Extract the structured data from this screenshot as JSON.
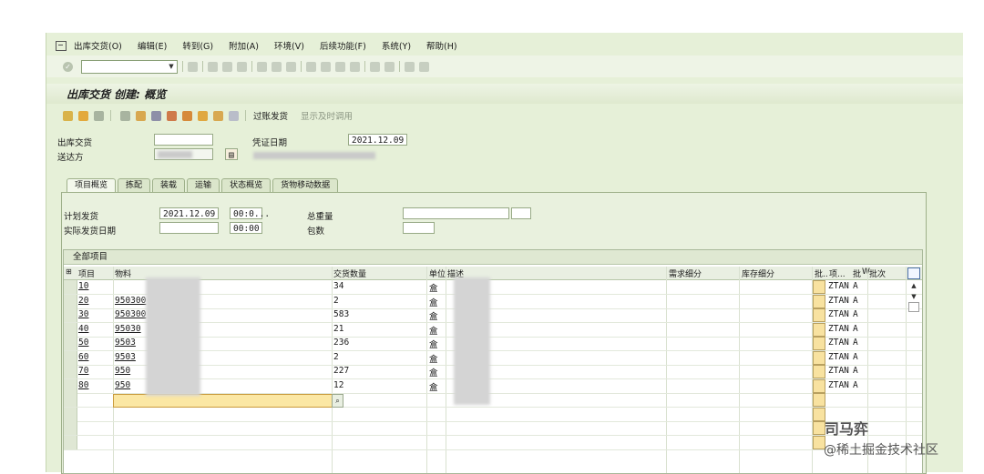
{
  "menu": [
    "出库交货(O)",
    "编辑(E)",
    "转到(G)",
    "附加(A)",
    "环境(V)",
    "后续功能(F)",
    "系统(Y)",
    "帮助(H)"
  ],
  "page_title": "出库交货 创建: 概览",
  "toolbar2": {
    "post_label": "过账发货",
    "display_label": "显示及时调用"
  },
  "header": {
    "delivery_label": "出库交货",
    "delivery_value": "",
    "ship_to_label": "送达方",
    "doc_date_label": "凭证日期",
    "doc_date_value": "2021.12.09"
  },
  "tabs": [
    "项目概览",
    "拣配",
    "装载",
    "运输",
    "状态概览",
    "货物移动数据"
  ],
  "overview": {
    "plan_gi_label": "计划发货",
    "plan_gi_date": "2021.12.09",
    "plan_gi_time": "00:0...",
    "actual_gi_label": "实际发货日期",
    "actual_gi_date": "",
    "actual_gi_time": "00:00",
    "total_weight_label": "总重量",
    "packages_label": "包数"
  },
  "table": {
    "title": "全部项目",
    "columns": [
      "项目",
      "物料",
      "交货数量",
      "单位",
      "描述",
      "需求细分",
      "库存细分",
      "批..",
      "项...",
      "批",
      "W",
      "批次"
    ],
    "rows": [
      {
        "item": "10",
        "material": "",
        "qty": "34",
        "unit": "盒",
        "cat": "ZTAN",
        "cat2": "A"
      },
      {
        "item": "20",
        "material": "950300",
        "qty": "2",
        "unit": "盒",
        "cat": "ZTAN",
        "cat2": "A"
      },
      {
        "item": "30",
        "material": "950300",
        "qty": "583",
        "unit": "盒",
        "cat": "ZTAN",
        "cat2": "A"
      },
      {
        "item": "40",
        "material": "95030",
        "qty": "21",
        "unit": "盒",
        "cat": "ZTAN",
        "cat2": "A"
      },
      {
        "item": "50",
        "material": "9503",
        "qty": "236",
        "unit": "盒",
        "cat": "ZTAN",
        "cat2": "A"
      },
      {
        "item": "60",
        "material": "9503",
        "qty": "2",
        "unit": "盒",
        "cat": "ZTAN",
        "cat2": "A"
      },
      {
        "item": "70",
        "material": "950",
        "qty": "227",
        "unit": "盒",
        "cat": "ZTAN",
        "cat2": "A"
      },
      {
        "item": "80",
        "material": "950",
        "qty": "12",
        "unit": "盒",
        "cat": "ZTAN",
        "cat2": "A"
      }
    ]
  },
  "watermark": {
    "line1": "司马弈",
    "line2": "@稀土掘金技术社区"
  }
}
